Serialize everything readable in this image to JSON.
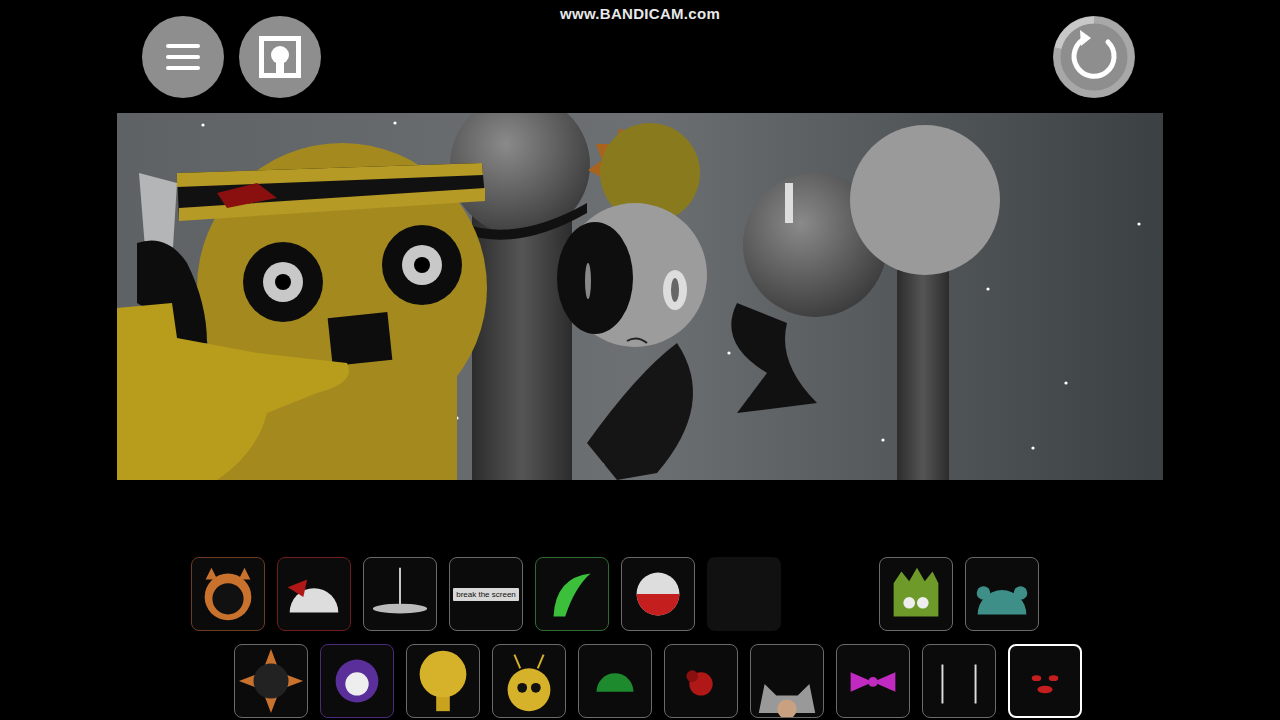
{
  "watermark": "www.BANDICAM.com",
  "tiles": {
    "row1": [
      {
        "kind": "icon",
        "selected": false,
        "color": "#6b3b22"
      },
      {
        "kind": "icon",
        "selected": false,
        "color": "#6e1c1c"
      },
      {
        "kind": "icon",
        "selected": false,
        "color": "#6a6a6a"
      },
      {
        "kind": "label",
        "label": "break the screen",
        "selected": false,
        "color": "#6a6a6a"
      },
      {
        "kind": "icon",
        "selected": false,
        "color": "#2f6b2f"
      },
      {
        "kind": "icon",
        "selected": false,
        "color": "#6a6a6a"
      },
      {
        "kind": "dim",
        "selected": false,
        "color": "#141414"
      },
      {
        "kind": "blank",
        "selected": false,
        "color": "#000000"
      },
      {
        "kind": "icon",
        "selected": false,
        "color": "#6a6a6a"
      },
      {
        "kind": "icon",
        "selected": false,
        "color": "#6a6a6a"
      }
    ],
    "row2": [
      {
        "kind": "icon",
        "selected": false,
        "color": "#6a6a6a"
      },
      {
        "kind": "icon",
        "selected": false,
        "color": "#4b2a7a"
      },
      {
        "kind": "icon",
        "selected": false,
        "color": "#6a6a6a"
      },
      {
        "kind": "icon",
        "selected": false,
        "color": "#6a6a6a"
      },
      {
        "kind": "icon",
        "selected": false,
        "color": "#6a6a6a"
      },
      {
        "kind": "icon",
        "selected": false,
        "color": "#6a6a6a"
      },
      {
        "kind": "icon",
        "selected": false,
        "color": "#6a6a6a"
      },
      {
        "kind": "icon",
        "selected": false,
        "color": "#6a6a6a"
      },
      {
        "kind": "icon",
        "selected": false,
        "color": "#6a6a6a"
      },
      {
        "kind": "icon",
        "selected": true,
        "color": "#ffffff"
      }
    ]
  }
}
